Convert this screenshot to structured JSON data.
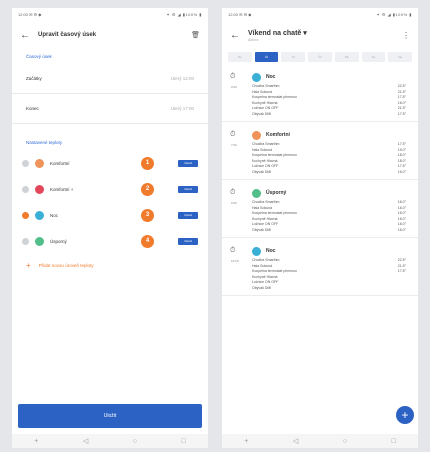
{
  "left": {
    "status": {
      "left": "12:00 ✉ ⚙ ◆",
      "right": "✦ ⚙ ◢ ▮100% ▮"
    },
    "title": "Upravit časový úsek",
    "section_time": "Časový úsek",
    "start": {
      "label": "Začátky",
      "value": "Úterý 12:00"
    },
    "end": {
      "label": "Konec",
      "value": "Úterý 17:00"
    },
    "section_temps": "Nastavené teploty",
    "temps": [
      {
        "label": "Komfortní",
        "icon_color": "#f0935a",
        "badge": "1",
        "edit": "Upravit",
        "checked": false
      },
      {
        "label": "Komfortní +",
        "icon_color": "#e5475a",
        "badge": "2",
        "edit": "Upravit",
        "checked": false
      },
      {
        "label": "Noc",
        "icon_color": "#3ab0d6",
        "badge": "3",
        "edit": "Upravit",
        "checked": true
      },
      {
        "label": "Úsporný",
        "icon_color": "#52be8a",
        "badge": "4",
        "edit": "Upravit",
        "checked": false
      }
    ],
    "add_label": "Přidat novou úroveň teploty",
    "save": "Uložit"
  },
  "right": {
    "status": {
      "left": "12:00 ✉ ⚙ ◆",
      "right": "✦ ⚙ ◢ ▮100% ▮"
    },
    "title": "Víkend na chatě",
    "title_caret": "▾",
    "subtitle": "Aktivní",
    "tabs": [
      "Po",
      "Út",
      "St",
      "Čt",
      "Pá",
      "So",
      "Ne"
    ],
    "active_tab": 1,
    "slots": [
      {
        "name": "Noc",
        "time": "0:00",
        "icon_color": "#3ab0d6",
        "rooms": [
          {
            "name": "Chodba Smarthm",
            "temp": "22.5°"
          },
          {
            "name": "Hala Sokuná",
            "temp": "21.5°"
          },
          {
            "name": "Koupelna termostat plnmonu",
            "temp": "17.5°"
          },
          {
            "name": "Kuchyně Hlavná",
            "temp": "16.0°"
          },
          {
            "name": "Ložnice ON OFF",
            "temp": "21.5°"
          },
          {
            "name": "Obývák DMI",
            "temp": "17.5°"
          }
        ]
      },
      {
        "name": "Komfortní",
        "time": "7:00",
        "icon_color": "#f0935a",
        "rooms": [
          {
            "name": "Chodba Smarthm",
            "temp": "17.5°"
          },
          {
            "name": "Hala Sokuná",
            "temp": "19.0°"
          },
          {
            "name": "Koupelna termostat plnmonu",
            "temp": "18.0°"
          },
          {
            "name": "Kuchyně Hlavná",
            "temp": "18.0°"
          },
          {
            "name": "Ložnice ON OFF",
            "temp": "17.5°"
          },
          {
            "name": "Obývák DMI",
            "temp": "16.0°"
          }
        ]
      },
      {
        "name": "Úsporný",
        "time": "9:00",
        "icon_color": "#52be8a",
        "rooms": [
          {
            "name": "Chodba Smarthm",
            "temp": "16.0°"
          },
          {
            "name": "Hala Sokuná",
            "temp": "16.0°"
          },
          {
            "name": "Koupelna termostat plnmonu",
            "temp": "16.0°"
          },
          {
            "name": "Kuchyně Hlavná",
            "temp": "16.0°"
          },
          {
            "name": "Ložnice ON OFF",
            "temp": "16.0°"
          },
          {
            "name": "Obývák DMI",
            "temp": "16.0°"
          }
        ]
      },
      {
        "name": "Noc",
        "time": "16:00",
        "icon_color": "#3ab0d6",
        "rooms": [
          {
            "name": "Chodba Smarthm",
            "temp": "22.5°"
          },
          {
            "name": "Hala Sokuná",
            "temp": "21.5°"
          },
          {
            "name": "Koupelna termostat plnmonu",
            "temp": "17.5°"
          },
          {
            "name": "Kuchyně Hlavná",
            "temp": ""
          },
          {
            "name": "Ložnice ON OFF",
            "temp": ""
          },
          {
            "name": "Obývák DMI",
            "temp": ""
          }
        ]
      }
    ],
    "fab": "+"
  },
  "nav": [
    "+",
    "◁",
    "○",
    "□"
  ]
}
